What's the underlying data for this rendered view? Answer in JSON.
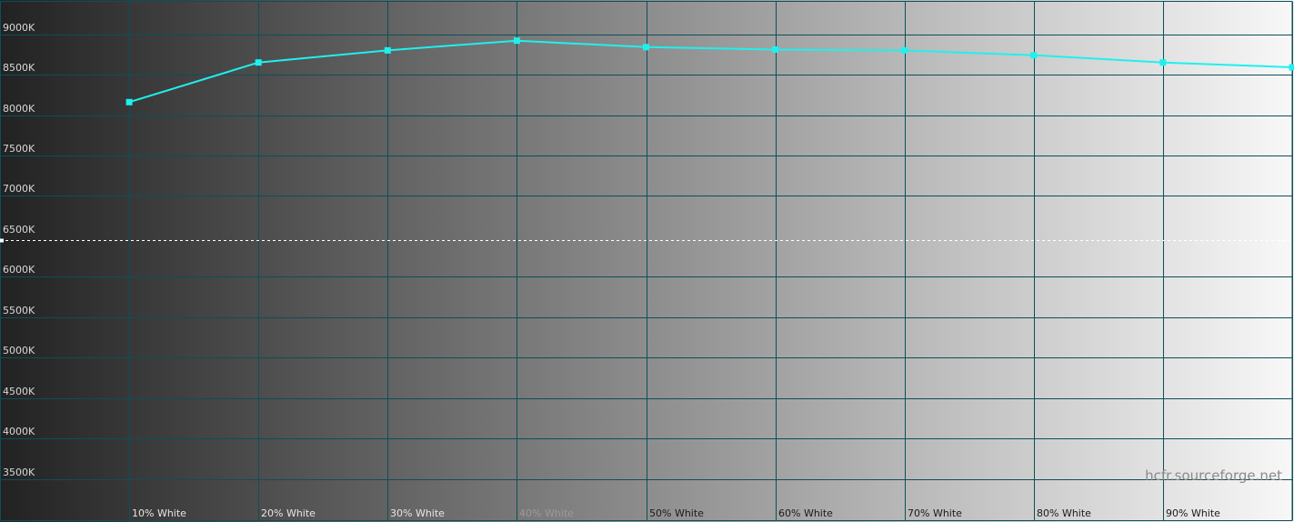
{
  "chart_data": {
    "type": "line",
    "categories": [
      "",
      "10% White",
      "20% White",
      "30% White",
      "40% White",
      "50% White",
      "60% White",
      "70% White",
      "80% White",
      "90% White",
      ""
    ],
    "series": [
      {
        "values": [
          null,
          8160,
          8650,
          8800,
          8920,
          8840,
          8810,
          8800,
          8740,
          8650,
          8590
        ]
      }
    ],
    "y_ticks": [
      "9000K",
      "8500K",
      "8000K",
      "7500K",
      "7000K",
      "6500K",
      "6000K",
      "5500K",
      "5000K",
      "4500K",
      "4000K",
      "3500K"
    ],
    "ylim": [
      3000,
      9400
    ],
    "reference_line": 6450,
    "grid": true,
    "colors": {
      "series": "#1ff0ee",
      "grid": "#0d4f57",
      "reference": "#ffffff",
      "background_start": "#222222",
      "background_end": "#f8f8f8"
    },
    "watermark": "hcfr.sourceforge.net"
  }
}
